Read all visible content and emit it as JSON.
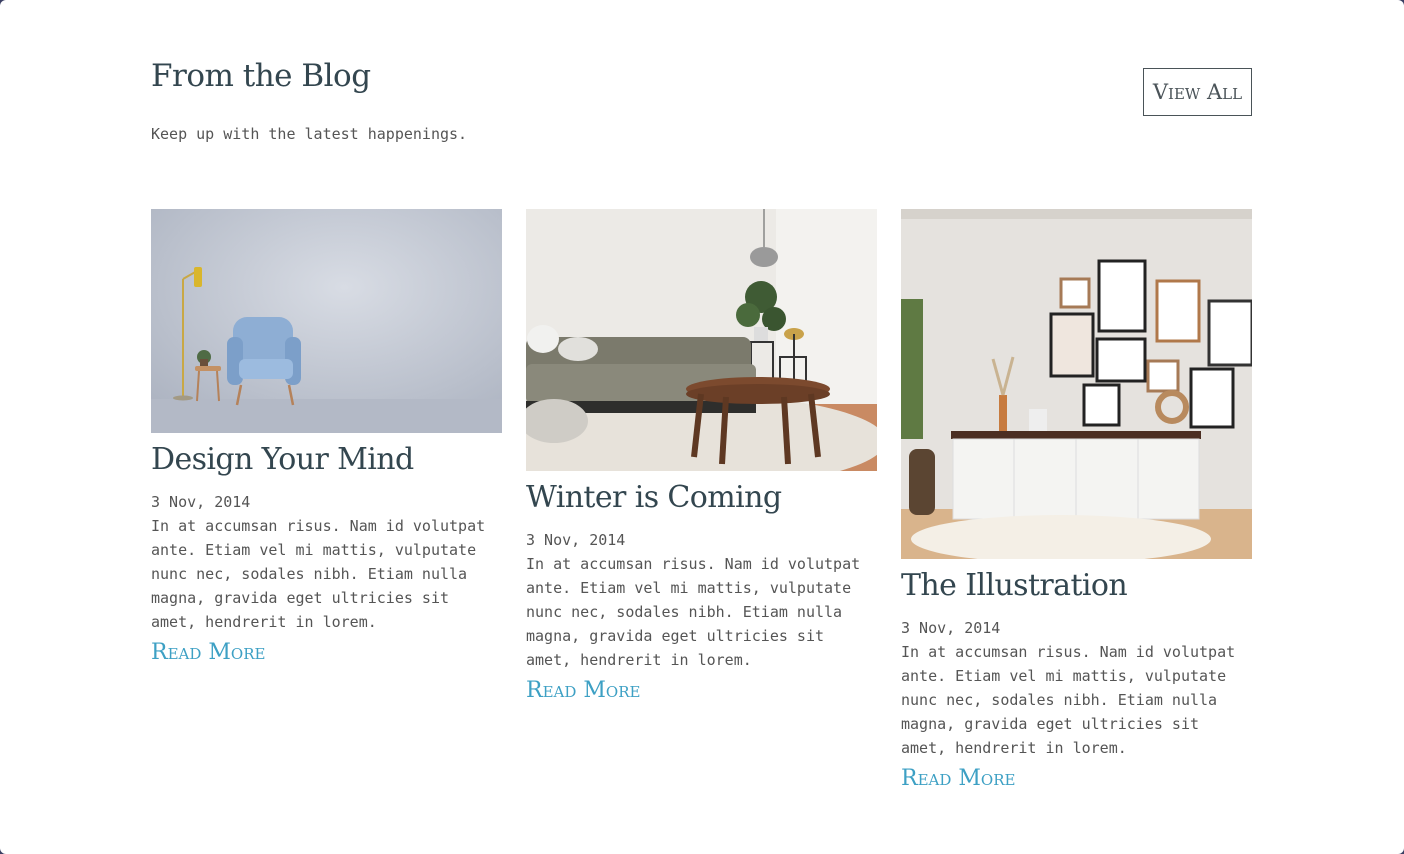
{
  "section": {
    "title": "From the Blog",
    "subtitle": "Keep up with the latest happenings.",
    "view_all_label": "View All"
  },
  "posts": [
    {
      "title": "Design Your Mind",
      "date": "3 Nov, 2014",
      "excerpt": "In at accumsan risus. Nam id volutpat ante. Etiam vel mi mattis, vulputate nunc nec, sodales nibh. Etiam nulla magna, gravida eget ultricies sit amet, hendrerit in lorem.",
      "read_more_label": "Read More",
      "image": "blue-armchair-photo"
    },
    {
      "title": "Winter is Coming",
      "date": "3 Nov, 2014",
      "excerpt": "In at accumsan risus. Nam id volutpat ante. Etiam vel mi mattis, vulputate nunc nec, sodales nibh. Etiam nulla magna, gravida eget ultricies sit amet, hendrerit in lorem.",
      "read_more_label": "Read More",
      "image": "living-room-sofa-photo"
    },
    {
      "title": "The Illustration",
      "date": "3 Nov, 2014",
      "excerpt": "In at accumsan risus. Nam id volutpat ante. Etiam vel mi mattis, vulputate nunc nec, sodales nibh. Etiam nulla magna, gravida eget ultricies sit amet, hendrerit in lorem.",
      "read_more_label": "Read More",
      "image": "gallery-wall-sideboard-photo"
    }
  ],
  "colors": {
    "heading": "#33464f",
    "body_text": "#555555",
    "link": "#3da0c4",
    "button_border": "#4a5358"
  }
}
